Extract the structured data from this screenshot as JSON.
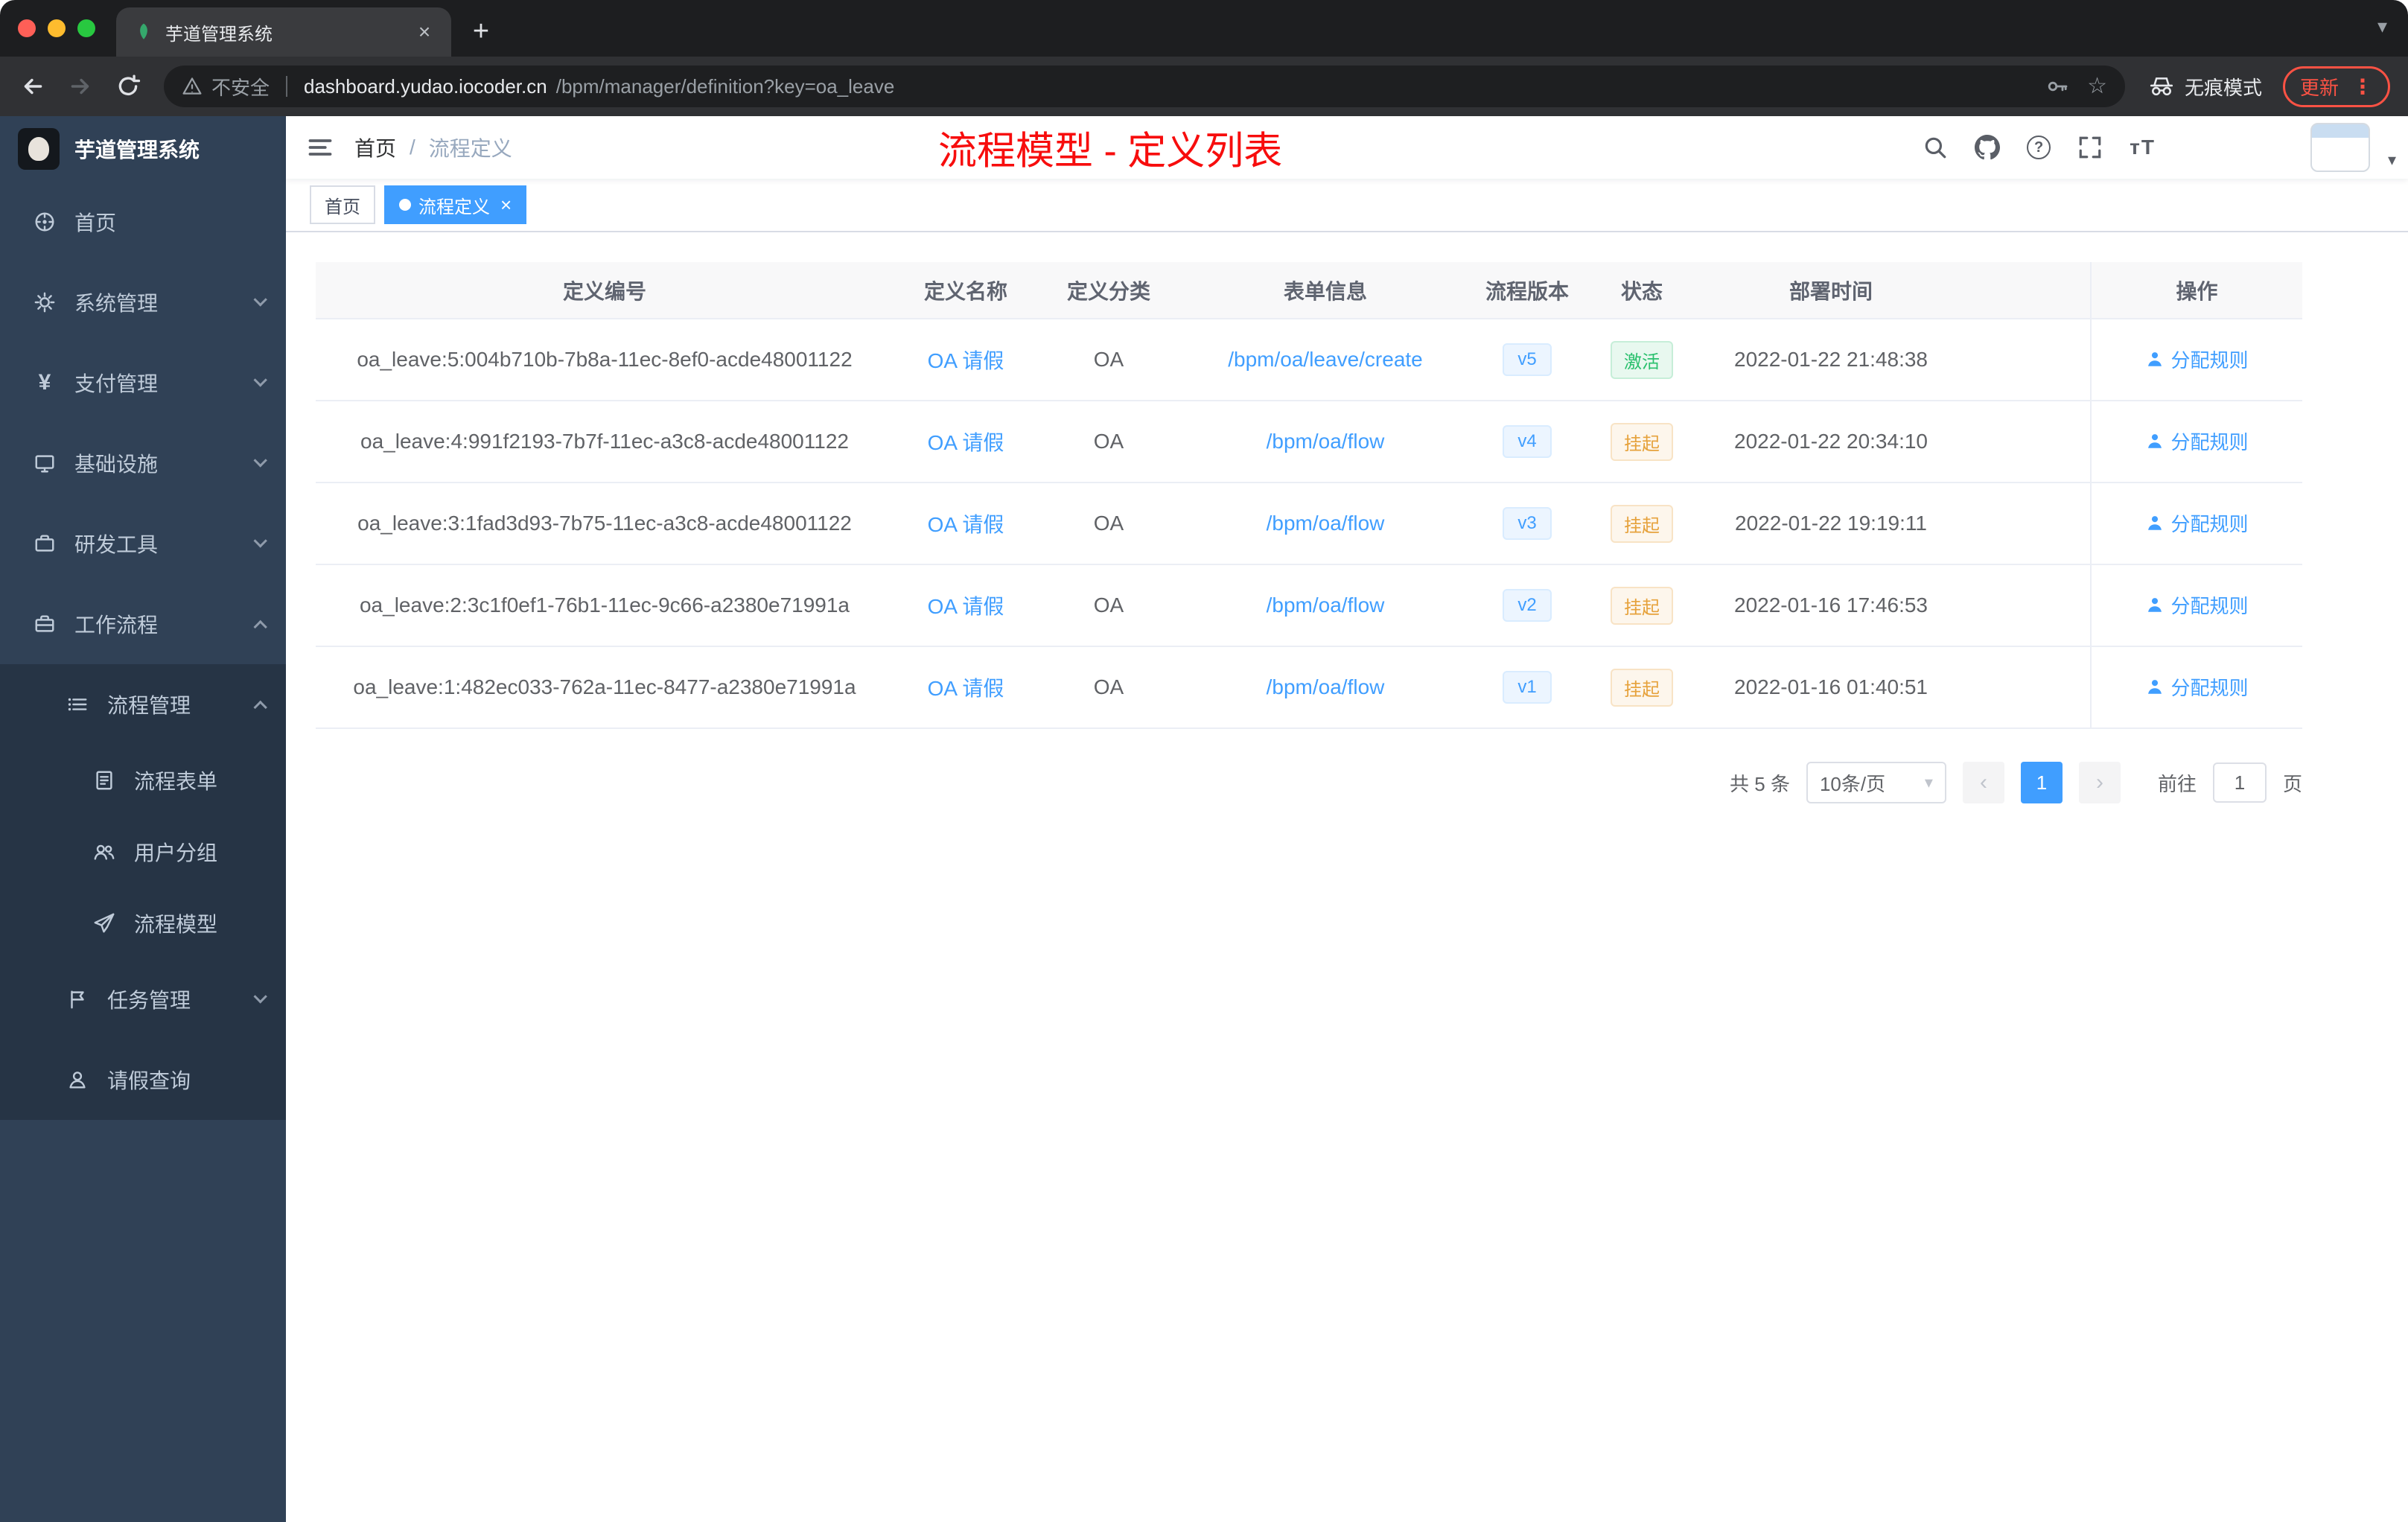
{
  "browser": {
    "tab_title": "芋道管理系统",
    "security_label": "不安全",
    "url_host": "dashboard.yudao.iocoder.cn",
    "url_path": "/bpm/manager/definition?key=oa_leave",
    "incognito_label": "无痕模式",
    "update_label": "更新"
  },
  "icons": {
    "close": "×",
    "plus": "+",
    "more": "⋮",
    "star": "☆",
    "question": "?",
    "caret_down": "▾",
    "chevron_left": "‹",
    "chevron_right": "›",
    "yen": "¥",
    "font_resize": "тT",
    "slash": "/"
  },
  "sidebar": {
    "brand": "芋道管理系统",
    "items": [
      {
        "label": "首页"
      },
      {
        "label": "系统管理"
      },
      {
        "label": "支付管理"
      },
      {
        "label": "基础设施"
      },
      {
        "label": "研发工具"
      },
      {
        "label": "工作流程"
      },
      {
        "label": "流程管理"
      },
      {
        "label": "流程表单"
      },
      {
        "label": "用户分组"
      },
      {
        "label": "流程模型"
      },
      {
        "label": "任务管理"
      },
      {
        "label": "请假查询"
      }
    ]
  },
  "navbar": {
    "breadcrumb": [
      "首页",
      "流程定义"
    ],
    "title": "流程模型 - 定义列表"
  },
  "tags": [
    {
      "label": "首页"
    },
    {
      "label": "流程定义"
    }
  ],
  "table": {
    "headers": [
      "定义编号",
      "定义名称",
      "定义分类",
      "表单信息",
      "流程版本",
      "状态",
      "部署时间",
      "操作"
    ],
    "rows": [
      {
        "id": "oa_leave:5:004b710b-7b8a-11ec-8ef0-acde48001122",
        "name": "OA 请假",
        "category": "OA",
        "form": "/bpm/oa/leave/create",
        "version": "v5",
        "status": "激活",
        "status_type": "success",
        "time": "2022-01-22 21:48:38",
        "action": "分配规则"
      },
      {
        "id": "oa_leave:4:991f2193-7b7f-11ec-a3c8-acde48001122",
        "name": "OA 请假",
        "category": "OA",
        "form": "/bpm/oa/flow",
        "version": "v4",
        "status": "挂起",
        "status_type": "warning",
        "time": "2022-01-22 20:34:10",
        "action": "分配规则"
      },
      {
        "id": "oa_leave:3:1fad3d93-7b75-11ec-a3c8-acde48001122",
        "name": "OA 请假",
        "category": "OA",
        "form": "/bpm/oa/flow",
        "version": "v3",
        "status": "挂起",
        "status_type": "warning",
        "time": "2022-01-22 19:19:11",
        "action": "分配规则"
      },
      {
        "id": "oa_leave:2:3c1f0ef1-76b1-11ec-9c66-a2380e71991a",
        "name": "OA 请假",
        "category": "OA",
        "form": "/bpm/oa/flow",
        "version": "v2",
        "status": "挂起",
        "status_type": "warning",
        "time": "2022-01-16 17:46:53",
        "action": "分配规则"
      },
      {
        "id": "oa_leave:1:482ec033-762a-11ec-8477-a2380e71991a",
        "name": "OA 请假",
        "category": "OA",
        "form": "/bpm/oa/flow",
        "version": "v1",
        "status": "挂起",
        "status_type": "warning",
        "time": "2022-01-16 01:40:51",
        "action": "分配规则"
      }
    ]
  },
  "pagination": {
    "total": "共 5 条",
    "page_size": "10条/页",
    "current_page": "1",
    "goto_label": "前往",
    "goto_value": "1",
    "page_unit": "页"
  },
  "colors": {
    "accent": "#409eff",
    "success": "#2ac06d",
    "warning": "#e6a23c",
    "title_red": "#f70d0d",
    "update_red": "#fb5244"
  }
}
